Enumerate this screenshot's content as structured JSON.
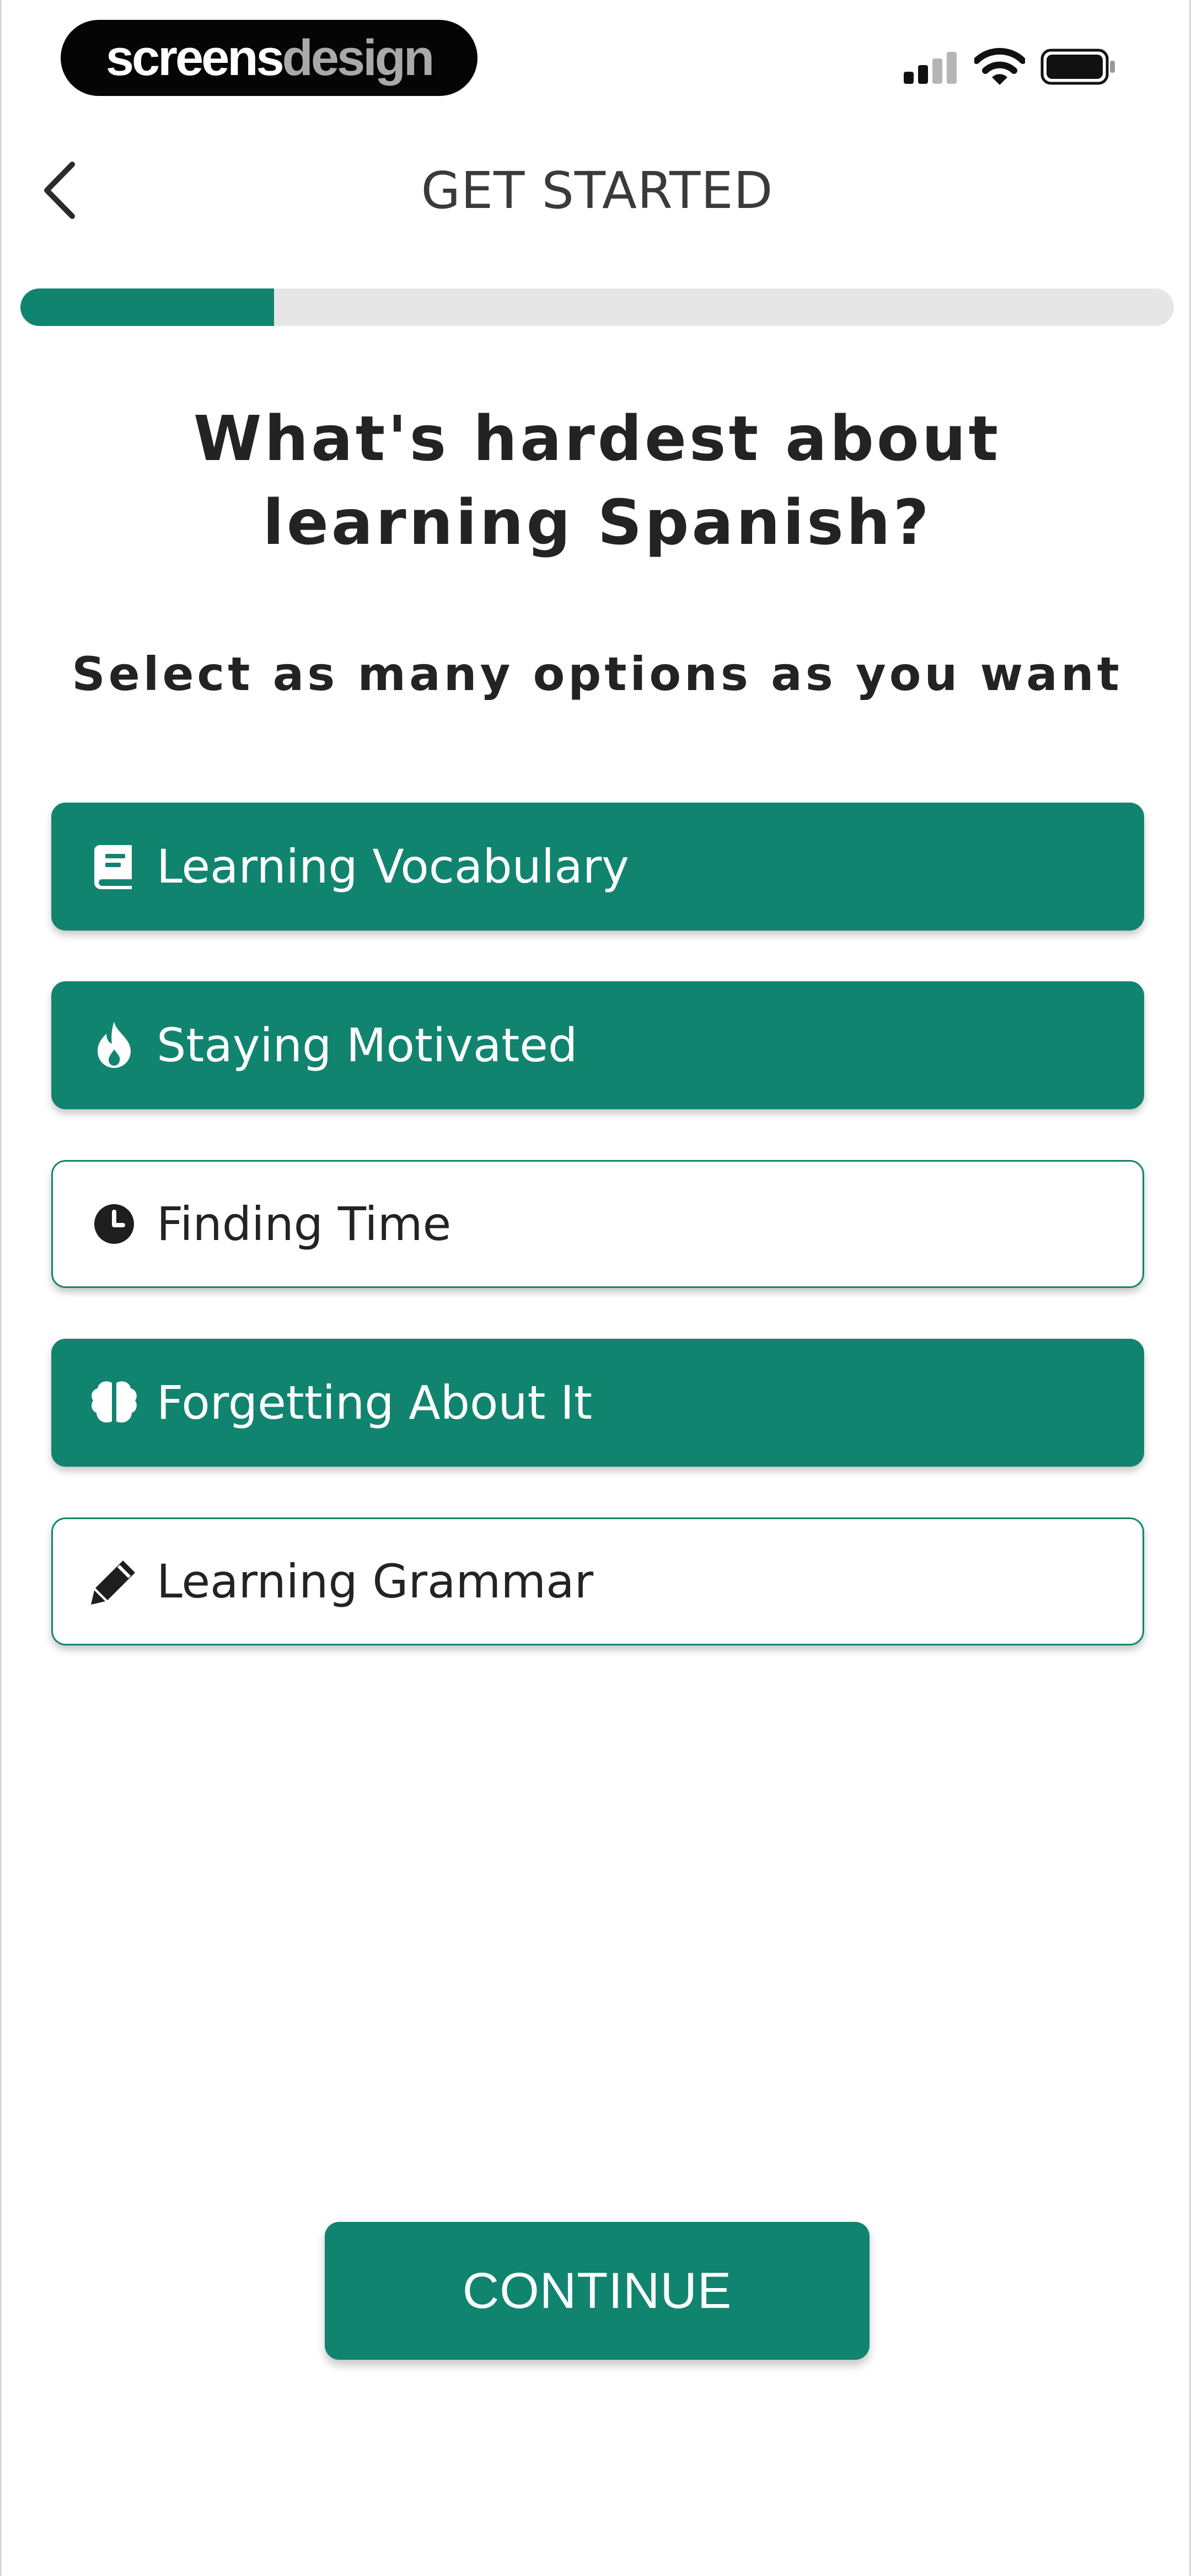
{
  "status_bar": {
    "brand_part1": "screens",
    "brand_part2": "design",
    "signal_icon": "cellular-signal-icon",
    "wifi_icon": "wifi-icon",
    "battery_icon": "battery-icon"
  },
  "header": {
    "back_icon": "chevron-left-icon",
    "title": "GET STARTED"
  },
  "progress": {
    "fraction": 0.22,
    "fill_color": "#118470",
    "track_color": "#e6e6e6"
  },
  "question": {
    "title": "What's hardest about learning Spanish?",
    "subtitle": "Select as many options as you want"
  },
  "options": [
    {
      "label": "Learning Vocabulary",
      "icon": "book-icon",
      "selected": true
    },
    {
      "label": "Staying Motivated",
      "icon": "flame-icon",
      "selected": true
    },
    {
      "label": "Finding Time",
      "icon": "clock-icon",
      "selected": false
    },
    {
      "label": "Forgetting About It",
      "icon": "brain-icon",
      "selected": true
    },
    {
      "label": "Learning Grammar",
      "icon": "pencil-icon",
      "selected": false
    }
  ],
  "continue": {
    "label": "CONTINUE"
  },
  "colors": {
    "accent": "#118470",
    "text_dark": "#232323",
    "background": "#ffffff"
  }
}
